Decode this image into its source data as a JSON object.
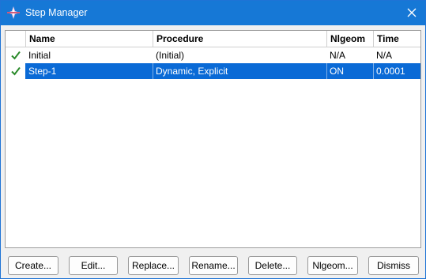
{
  "window": {
    "title": "Step Manager",
    "accent_color": "#1678d6",
    "selection_color": "#0a6ad6"
  },
  "table": {
    "columns": [
      "Name",
      "Procedure",
      "Nlgeom",
      "Time"
    ],
    "rows": [
      {
        "status_icon": "checkmark-icon",
        "name": "Initial",
        "procedure": "(Initial)",
        "nlgeom": "N/A",
        "time": "N/A",
        "selected": false
      },
      {
        "status_icon": "checkmark-icon",
        "name": "Step-1",
        "procedure": "Dynamic, Explicit",
        "nlgeom": "ON",
        "time": "0.0001",
        "selected": true
      }
    ]
  },
  "buttons": {
    "create": "Create...",
    "edit": "Edit...",
    "replace": "Replace...",
    "rename": "Rename...",
    "delete": "Delete...",
    "nlgeom": "Nlgeom...",
    "dismiss": "Dismiss"
  }
}
